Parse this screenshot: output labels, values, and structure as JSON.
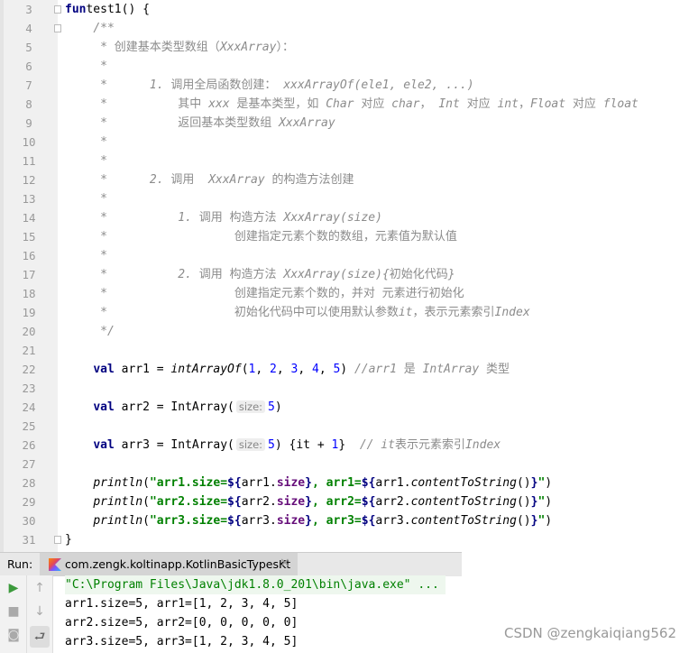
{
  "editor": {
    "lines": [
      {
        "n": "3",
        "t": [
          [
            "kw",
            "fun"
          ],
          [
            "",
            "test1() {"
          ]
        ]
      },
      {
        "n": "4",
        "t": [
          [
            "",
            "    "
          ],
          [
            "cm",
            "/**"
          ]
        ]
      },
      {
        "n": "5",
        "t": [
          [
            "cm",
            "     * "
          ],
          [
            "cmz",
            "创建基本类型数组（"
          ],
          [
            "cm",
            "XxxArray"
          ],
          [
            "cmz",
            "）："
          ]
        ]
      },
      {
        "n": "6",
        "t": [
          [
            "cm",
            "     *"
          ]
        ]
      },
      {
        "n": "7",
        "t": [
          [
            "cm",
            "     *      1. "
          ],
          [
            "cmz",
            "调用全局函数创建： "
          ],
          [
            "cm",
            "xxxArrayOf(ele1, ele2, ...)"
          ]
        ]
      },
      {
        "n": "8",
        "t": [
          [
            "cm",
            "     *          "
          ],
          [
            "cmz",
            "其中 "
          ],
          [
            "cm",
            "xxx "
          ],
          [
            "cmz",
            "是基本类型，如 "
          ],
          [
            "cm",
            "Char "
          ],
          [
            "cmz",
            "对应 "
          ],
          [
            "cm",
            "char"
          ],
          [
            "cmz",
            "， "
          ],
          [
            "cm",
            "Int "
          ],
          [
            "cmz",
            "对应 "
          ],
          [
            "cm",
            "int"
          ],
          [
            "cmz",
            "，"
          ],
          [
            "cm",
            "Float "
          ],
          [
            "cmz",
            "对应 "
          ],
          [
            "cm",
            "float"
          ]
        ]
      },
      {
        "n": "9",
        "t": [
          [
            "cm",
            "     *          "
          ],
          [
            "cmz",
            "返回基本类型数组 "
          ],
          [
            "cm",
            "XxxArray"
          ]
        ]
      },
      {
        "n": "10",
        "t": [
          [
            "cm",
            "     *"
          ]
        ]
      },
      {
        "n": "11",
        "t": [
          [
            "cm",
            "     *"
          ]
        ]
      },
      {
        "n": "12",
        "t": [
          [
            "cm",
            "     *      2. "
          ],
          [
            "cmz",
            "调用  "
          ],
          [
            "cm",
            "XxxArray "
          ],
          [
            "cmz",
            "的构造方法创建"
          ]
        ]
      },
      {
        "n": "13",
        "t": [
          [
            "cm",
            "     *"
          ]
        ]
      },
      {
        "n": "14",
        "t": [
          [
            "cm",
            "     *          1. "
          ],
          [
            "cmz",
            "调用 构造方法 "
          ],
          [
            "cm",
            "XxxArray(size)"
          ]
        ]
      },
      {
        "n": "15",
        "t": [
          [
            "cm",
            "     *                  "
          ],
          [
            "cmz",
            "创建指定元素个数的数组，元素值为默认值"
          ]
        ]
      },
      {
        "n": "16",
        "t": [
          [
            "cm",
            "     *"
          ]
        ]
      },
      {
        "n": "17",
        "t": [
          [
            "cm",
            "     *          2. "
          ],
          [
            "cmz",
            "调用 构造方法 "
          ],
          [
            "cm",
            "XxxArray(size){"
          ],
          [
            "cmz",
            "初始化代码"
          ],
          [
            "cm",
            "}"
          ]
        ]
      },
      {
        "n": "18",
        "t": [
          [
            "cm",
            "     *                  "
          ],
          [
            "cmz",
            "创建指定元素个数的，并对 元素进行初始化"
          ]
        ]
      },
      {
        "n": "19",
        "t": [
          [
            "cm",
            "     *                  "
          ],
          [
            "cmz",
            "初始化代码中可以使用默认参数"
          ],
          [
            "cm",
            "it"
          ],
          [
            "cmz",
            "，表示元素索引"
          ],
          [
            "cm",
            "Index"
          ]
        ]
      },
      {
        "n": "20",
        "t": [
          [
            "cm",
            "     */"
          ]
        ]
      },
      {
        "n": "21",
        "t": []
      },
      {
        "n": "22",
        "t": [
          [
            "",
            "    "
          ],
          [
            "kw",
            "val"
          ],
          [
            "",
            " arr1 = "
          ],
          [
            "it",
            "intArrayOf"
          ],
          [
            "",
            "("
          ],
          [
            "num",
            "1"
          ],
          [
            "",
            ", "
          ],
          [
            "num",
            "2"
          ],
          [
            "",
            ", "
          ],
          [
            "num",
            "3"
          ],
          [
            "",
            ", "
          ],
          [
            "num",
            "4"
          ],
          [
            "",
            ", "
          ],
          [
            "num",
            "5"
          ],
          [
            "",
            ") "
          ],
          [
            "cm",
            "//arr1 "
          ],
          [
            "cmz",
            "是 "
          ],
          [
            "cm",
            "IntArray "
          ],
          [
            "cmz",
            "类型"
          ]
        ]
      },
      {
        "n": "23",
        "t": []
      },
      {
        "n": "24",
        "t": [
          [
            "",
            "    "
          ],
          [
            "kw",
            "val"
          ],
          [
            "",
            " arr2 = IntArray("
          ],
          [
            "hint",
            "size:"
          ],
          [
            "num",
            "5"
          ],
          [
            "",
            ")"
          ]
        ]
      },
      {
        "n": "25",
        "t": []
      },
      {
        "n": "26",
        "t": [
          [
            "",
            "    "
          ],
          [
            "kw",
            "val"
          ],
          [
            "",
            " arr3 = IntArray("
          ],
          [
            "hint",
            "size:"
          ],
          [
            "num",
            "5"
          ],
          [
            "",
            ") {it + "
          ],
          [
            "num",
            "1"
          ],
          [
            "",
            "}  "
          ],
          [
            "cm",
            "// it"
          ],
          [
            "cmz",
            "表示元素索引"
          ],
          [
            "cm",
            "Index"
          ]
        ]
      },
      {
        "n": "27",
        "t": []
      },
      {
        "n": "28",
        "t": [
          [
            "",
            "    "
          ],
          [
            "it",
            "println"
          ],
          [
            "",
            "("
          ],
          [
            "str",
            "\"arr1.size="
          ],
          [
            "kw",
            "${"
          ],
          [
            "",
            "arr1."
          ],
          [
            "prop",
            "size"
          ],
          [
            "kw",
            "}"
          ],
          [
            "str",
            ", arr1="
          ],
          [
            "kw",
            "${"
          ],
          [
            "",
            "arr1."
          ],
          [
            "it",
            "contentToString"
          ],
          [
            "",
            "()"
          ],
          [
            "kw",
            "}"
          ],
          [
            "str",
            "\""
          ],
          [
            "",
            ")"
          ]
        ]
      },
      {
        "n": "29",
        "t": [
          [
            "",
            "    "
          ],
          [
            "it",
            "println"
          ],
          [
            "",
            "("
          ],
          [
            "str",
            "\"arr2.size="
          ],
          [
            "kw",
            "${"
          ],
          [
            "",
            "arr2."
          ],
          [
            "prop",
            "size"
          ],
          [
            "kw",
            "}"
          ],
          [
            "str",
            ", arr2="
          ],
          [
            "kw",
            "${"
          ],
          [
            "",
            "arr2."
          ],
          [
            "it",
            "contentToString"
          ],
          [
            "",
            "()"
          ],
          [
            "kw",
            "}"
          ],
          [
            "str",
            "\""
          ],
          [
            "",
            ")"
          ]
        ]
      },
      {
        "n": "30",
        "t": [
          [
            "",
            "    "
          ],
          [
            "it",
            "println"
          ],
          [
            "",
            "("
          ],
          [
            "str",
            "\"arr3.size="
          ],
          [
            "kw",
            "${"
          ],
          [
            "",
            "arr3."
          ],
          [
            "prop",
            "size"
          ],
          [
            "kw",
            "}"
          ],
          [
            "str",
            ", arr3="
          ],
          [
            "kw",
            "${"
          ],
          [
            "",
            "arr3."
          ],
          [
            "it",
            "contentToString"
          ],
          [
            "",
            "()"
          ],
          [
            "kw",
            "}"
          ],
          [
            "str",
            "\""
          ],
          [
            "",
            ")"
          ]
        ]
      },
      {
        "n": "31",
        "t": [
          [
            "",
            "}"
          ]
        ]
      }
    ]
  },
  "run": {
    "label": "Run:",
    "tab_title": "com.zengk.koltinapp.KotlinBasicTypesKt",
    "close": "×"
  },
  "console": {
    "command": "\"C:\\Program Files\\Java\\jdk1.8.0_201\\bin\\java.exe\" ...",
    "output": [
      "arr1.size=5, arr1=[1, 2, 3, 4, 5]",
      "arr2.size=5, arr2=[0, 0, 0, 0, 0]",
      "arr3.size=5, arr3=[1, 2, 3, 4, 5]"
    ]
  },
  "icons": {
    "run": "play-icon",
    "stop": "stop-icon",
    "up": "arrow-up-icon",
    "down": "arrow-down-icon",
    "wrap": "soft-wrap-icon",
    "camera": "camera-icon"
  },
  "watermark": "CSDN @zengkaiqiang562"
}
